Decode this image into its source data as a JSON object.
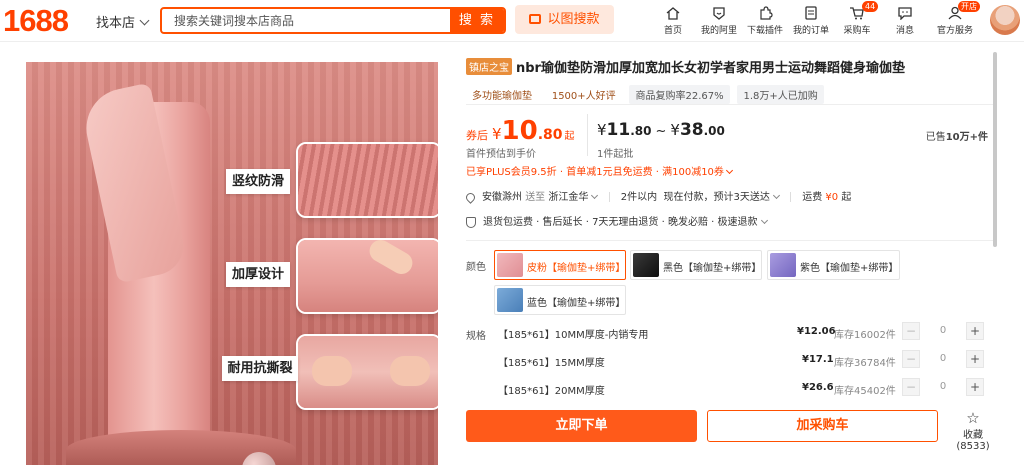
{
  "header": {
    "logo": "1688",
    "store_selector": "找本店",
    "search_placeholder": "搜索关键词搜本店商品",
    "search_button": "搜 索",
    "image_search_button": "以图搜款",
    "nav": [
      {
        "label": "首页",
        "icon": "home-icon"
      },
      {
        "label": "我的阿里",
        "icon": "my-alibaba-icon"
      },
      {
        "label": "下载插件",
        "icon": "plugin-icon"
      },
      {
        "label": "我的订单",
        "icon": "orders-icon"
      },
      {
        "label": "采购车",
        "icon": "cart-icon",
        "badge": "44"
      },
      {
        "label": "消息",
        "icon": "message-icon"
      },
      {
        "label": "官方服务",
        "icon": "service-icon",
        "badge": "开店"
      }
    ]
  },
  "gallery": {
    "features": [
      "竖纹防滑",
      "加厚设计",
      "耐用抗撕裂"
    ]
  },
  "product": {
    "store_tag": "镇店之宝",
    "title": "nbr瑜伽垫防滑加厚加宽加长女初学者家用男士运动舞蹈健身瑜伽垫",
    "tags": [
      "多功能瑜伽垫",
      "1500+人好评",
      "商品复购率22.67%",
      "1.8万+人已加购"
    ]
  },
  "price": {
    "after_coupon_label": "券后",
    "currency": "¥",
    "after_coupon_int": "10",
    "after_coupon_dec": ".80",
    "after_coupon_suffix": "起",
    "after_coupon_note": "首件预估到手价",
    "range_low_int": "11",
    "range_low_dec": ".80",
    "range_sep": "~",
    "range_high_int": "38",
    "range_high_dec": ".00",
    "min_batch": "1件起批",
    "sold_prefix": "已售",
    "sold_value": "10万+件"
  },
  "promo": "已享PLUS会员9.5折 · 首单减1元且免运费 · 满100减10券",
  "shipping": {
    "from": "安徽滁州",
    "to_label": "送至",
    "to": "浙江金华",
    "qty": "2件以内",
    "payment": "现在付款，预计3天送达",
    "freight_label": "运费",
    "freight_value": "¥0",
    "freight_suffix": "起"
  },
  "guarantees": "退货包运费 · 售后延长 · 7天无理由退货 · 晚发必赔 · 极速退款",
  "color": {
    "label": "颜色",
    "options": [
      {
        "name": "皮粉【瑜伽垫+绑带】",
        "swatch": "#e9a3a8",
        "selected": true
      },
      {
        "name": "黑色【瑜伽垫+绑带】",
        "swatch": "#1e1e1e",
        "selected": false
      },
      {
        "name": "紫色【瑜伽垫+绑带】",
        "swatch": "#8d7fd0",
        "selected": false
      },
      {
        "name": "蓝色【瑜伽垫+绑带】",
        "swatch": "#5b8fc7",
        "selected": false
      }
    ]
  },
  "spec": {
    "label": "规格",
    "rows": [
      {
        "name": "【185*61】10MM厚度-内销专用",
        "price": "¥12.06",
        "stock": "库存16002件",
        "qty": "0"
      },
      {
        "name": "【185*61】15MM厚度",
        "price": "¥17.1",
        "stock": "库存36784件",
        "qty": "0"
      },
      {
        "name": "【185*61】20MM厚度",
        "price": "¥26.6",
        "stock": "库存45402件",
        "qty": "0"
      }
    ]
  },
  "actions": {
    "buy_now": "立即下单",
    "add_to_cart": "加采购车",
    "favorite": "收藏 (8533)"
  },
  "colors": {
    "accent": "#ff5000",
    "price_red": "#ff4000"
  }
}
